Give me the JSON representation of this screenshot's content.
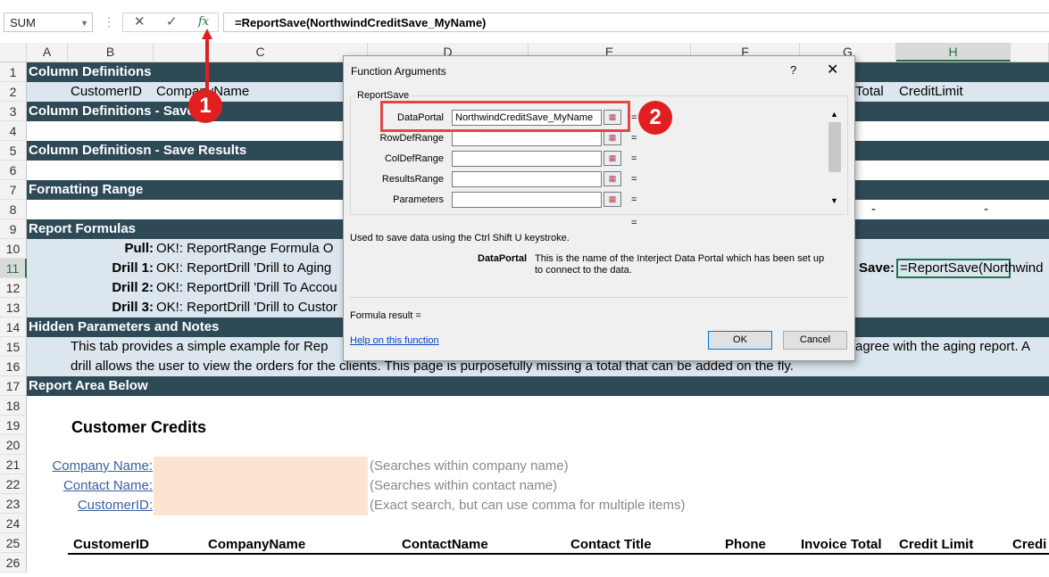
{
  "formula_bar": {
    "name_box": "SUM",
    "cancel_symbol": "✕",
    "enter_symbol": "✓",
    "fx_symbol": "fx",
    "formula": "=ReportSave(NorthwindCreditSave_MyName)"
  },
  "columns": [
    "A",
    "B",
    "C",
    "D",
    "E",
    "F",
    "G",
    "H"
  ],
  "rows": [
    "1",
    "2",
    "3",
    "4",
    "5",
    "6",
    "7",
    "8",
    "9",
    "10",
    "11",
    "12",
    "13",
    "14",
    "15",
    "16",
    "17",
    "18",
    "19",
    "20",
    "21",
    "22",
    "23",
    "24",
    "25",
    "26"
  ],
  "sheet": {
    "r1": "Column Definitions",
    "r2_customerid": "CustomerID",
    "r2_companyname": "CompanyName",
    "r2_total": "Total",
    "r2_creditlimit": "CreditLimit",
    "r3": "Column Definitions - Save",
    "r5": "Column Definitiosn - Save Results",
    "r7": "Formatting Range",
    "r8_dash1": "-",
    "r8_dash2": "-",
    "r9": "Report Formulas",
    "r10_label": "Pull:",
    "r10_value": "OK!: ReportRange Formula O",
    "r11_label": "Drill 1:",
    "r11_value": "OK!: ReportDrill 'Drill to Aging",
    "r11_save_label": "Save:",
    "r11_save_value": "=ReportSave(Northwind",
    "r12_label": "Drill 2:",
    "r12_value": "OK!: ReportDrill 'Drill To Accou",
    "r13_label": "Drill 3:",
    "r13_value": "OK!: ReportDrill 'Drill to Custor",
    "r14": "Hidden Parameters and Notes",
    "r15_text": "This tab provides a simple example for Rep",
    "r15_right": "agree with the aging report.  A",
    "r16_text": "drill allows the user to view the orders for the clients.   This page is purposefully missing a total that can be added on the fly.",
    "r17": "Report Area Below",
    "r19_title": "Customer Credits",
    "r21_label": "Company Name:",
    "r21_hint": "(Searches within company name)",
    "r22_label": "Contact Name:",
    "r22_hint": "(Searches within contact name)",
    "r23_label": "CustomerID:",
    "r23_hint": "(Exact search, but can use comma for multiple items)",
    "r25_headers": [
      "CustomerID",
      "CompanyName",
      "ContactName",
      "Contact Title",
      "Phone",
      "Invoice Total",
      "Credit Limit",
      "Credi"
    ]
  },
  "dialog": {
    "title": "Function Arguments",
    "help_symbol": "?",
    "close_symbol": "✕",
    "function_name": "ReportSave",
    "args": [
      {
        "label": "DataPortal",
        "value": "NorthwindCreditSave_MyName"
      },
      {
        "label": "RowDefRange",
        "value": ""
      },
      {
        "label": "ColDefRange",
        "value": ""
      },
      {
        "label": "ResultsRange",
        "value": ""
      },
      {
        "label": "Parameters",
        "value": ""
      }
    ],
    "equals": "=",
    "description": "Used to save data using the Ctrl Shift U keystroke.",
    "arg_desc_label": "DataPortal",
    "arg_desc_text_1": "This is the name of the Interject Data Portal which has been set up",
    "arg_desc_text_2": "to connect to the data.",
    "formula_result": "Formula result =",
    "help_link": "Help on this function",
    "ok": "OK",
    "cancel": "Cancel"
  },
  "annotations": {
    "badge1": "1",
    "badge2": "2",
    "color": "#e02020"
  }
}
